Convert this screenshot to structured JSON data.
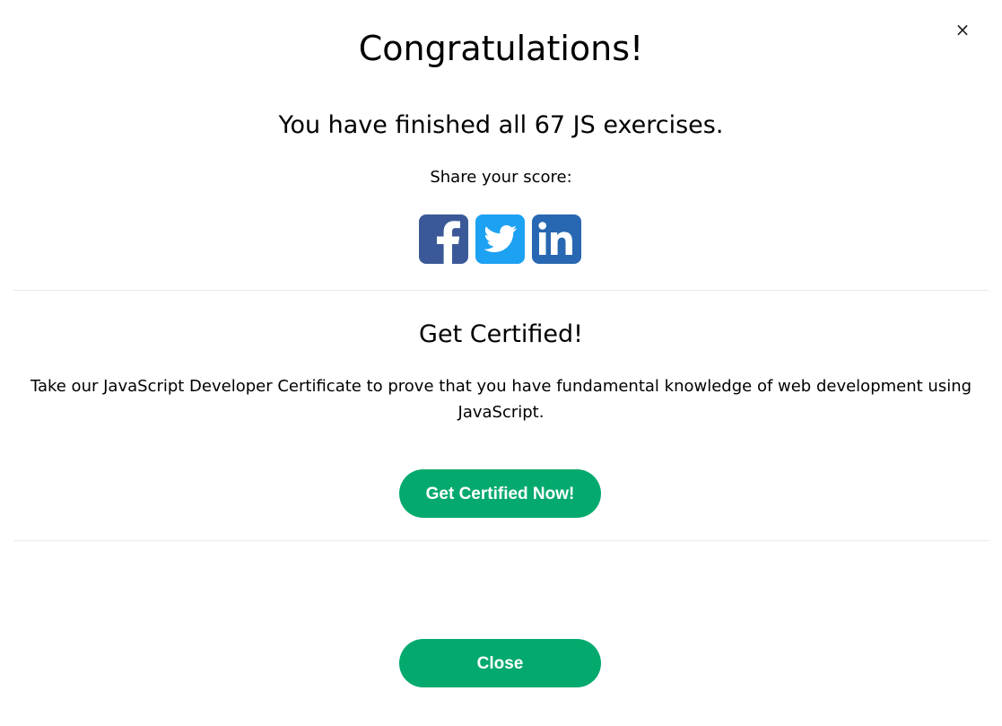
{
  "modal": {
    "close_symbol": "×",
    "title": "Congratulations!",
    "subtitle": "You have finished all 67 JS exercises.",
    "share_label": "Share your score:",
    "share_buttons": [
      {
        "name": "facebook",
        "icon": "facebook-icon",
        "color": "#3b5998"
      },
      {
        "name": "twitter",
        "icon": "twitter-icon",
        "color": "#1da1f2"
      },
      {
        "name": "linkedin",
        "icon": "linkedin-icon",
        "color": "#2867b2"
      }
    ],
    "certified": {
      "title": "Get Certified!",
      "description": "Take our JavaScript Developer Certificate to prove that you have fundamental knowledge of web development using JavaScript.",
      "button_label": "Get Certified Now!"
    },
    "close_button_label": "Close",
    "accent_color": "#04aa6d"
  }
}
